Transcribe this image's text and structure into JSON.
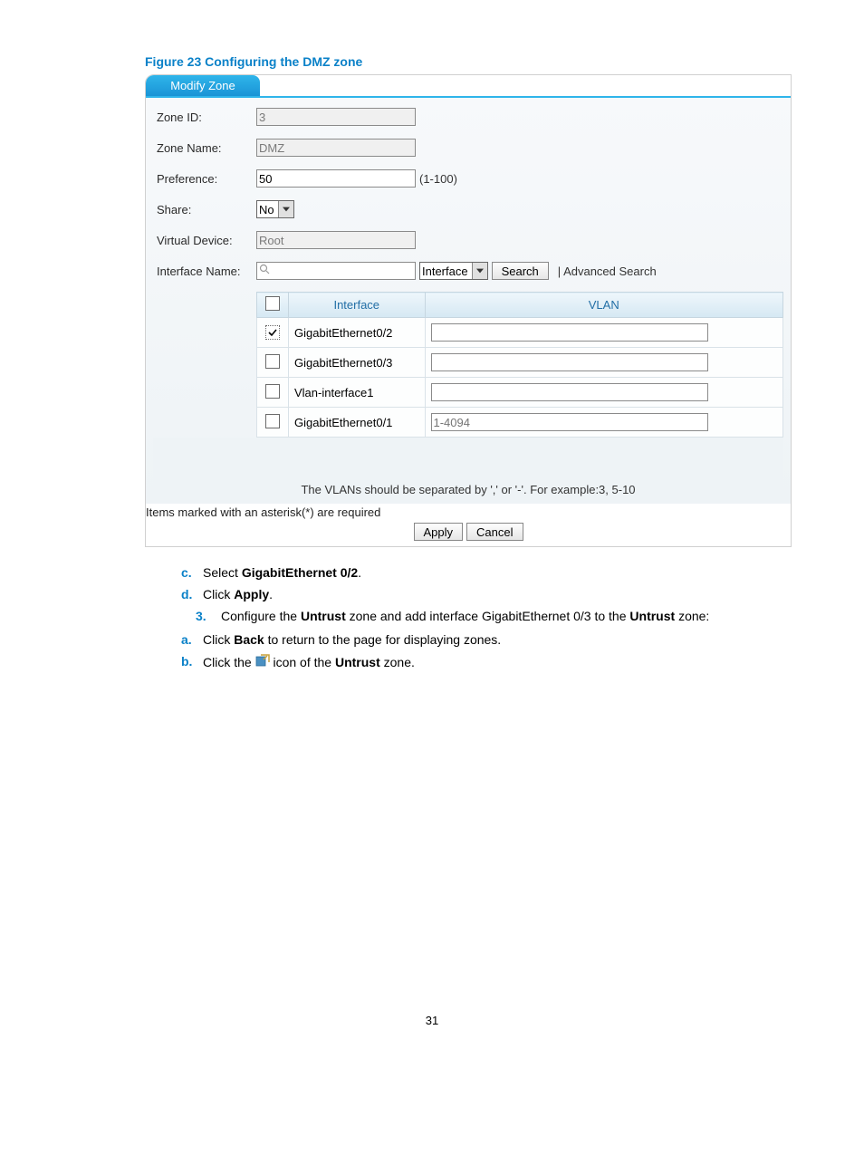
{
  "figure_caption": "Figure 23 Configuring the DMZ zone",
  "tab_label": "Modify Zone",
  "labels": {
    "zone_id": "Zone ID:",
    "zone_name": "Zone Name:",
    "preference": "Preference:",
    "share": "Share:",
    "virtual_device": "Virtual Device:",
    "interface_name": "Interface Name:"
  },
  "values": {
    "zone_id": "3",
    "zone_name": "DMZ",
    "preference": "50",
    "share": "No",
    "virtual_device": "Root",
    "search_value": ""
  },
  "hints": {
    "preference_range": "(1-100)"
  },
  "search": {
    "dropdown": "Interface",
    "button": "Search",
    "advanced": "| Advanced Search"
  },
  "table": {
    "headers": {
      "interface": "Interface",
      "vlan": "VLAN"
    },
    "rows": [
      {
        "checked": true,
        "iface": "GigabitEthernet0/2",
        "vlan": ""
      },
      {
        "checked": false,
        "iface": "GigabitEthernet0/3",
        "vlan": ""
      },
      {
        "checked": false,
        "iface": "Vlan-interface1",
        "vlan": ""
      },
      {
        "checked": false,
        "iface": "GigabitEthernet0/1",
        "vlan": "1-4094"
      }
    ]
  },
  "vlan_note": "The VLANs should be separated by ',' or '-'. For example:3, 5-10",
  "asterisk_note": "Items marked with an asterisk(*) are required",
  "buttons": {
    "apply": "Apply",
    "cancel": "Cancel"
  },
  "instructions": {
    "c_bullet": "c.",
    "c_pre": "Select ",
    "c_bold": "GigabitEthernet 0/2",
    "c_post": ".",
    "d_bullet": "d.",
    "d_pre": "Click ",
    "d_bold": "Apply",
    "d_post": ".",
    "n3_bullet": "3.",
    "n3_pre": "Configure the ",
    "n3_b1": "Untrust",
    "n3_mid": " zone and add interface GigabitEthernet 0/3 to the ",
    "n3_b2": "Untrust",
    "n3_post": " zone:",
    "a_bullet": "a.",
    "a_pre": "Click ",
    "a_bold": "Back",
    "a_post": " to return to the page for displaying zones.",
    "b_bullet": "b.",
    "b_pre": "Click the ",
    "b_mid": " icon of the ",
    "b_bold": "Untrust",
    "b_post": " zone."
  },
  "page_number": "31"
}
